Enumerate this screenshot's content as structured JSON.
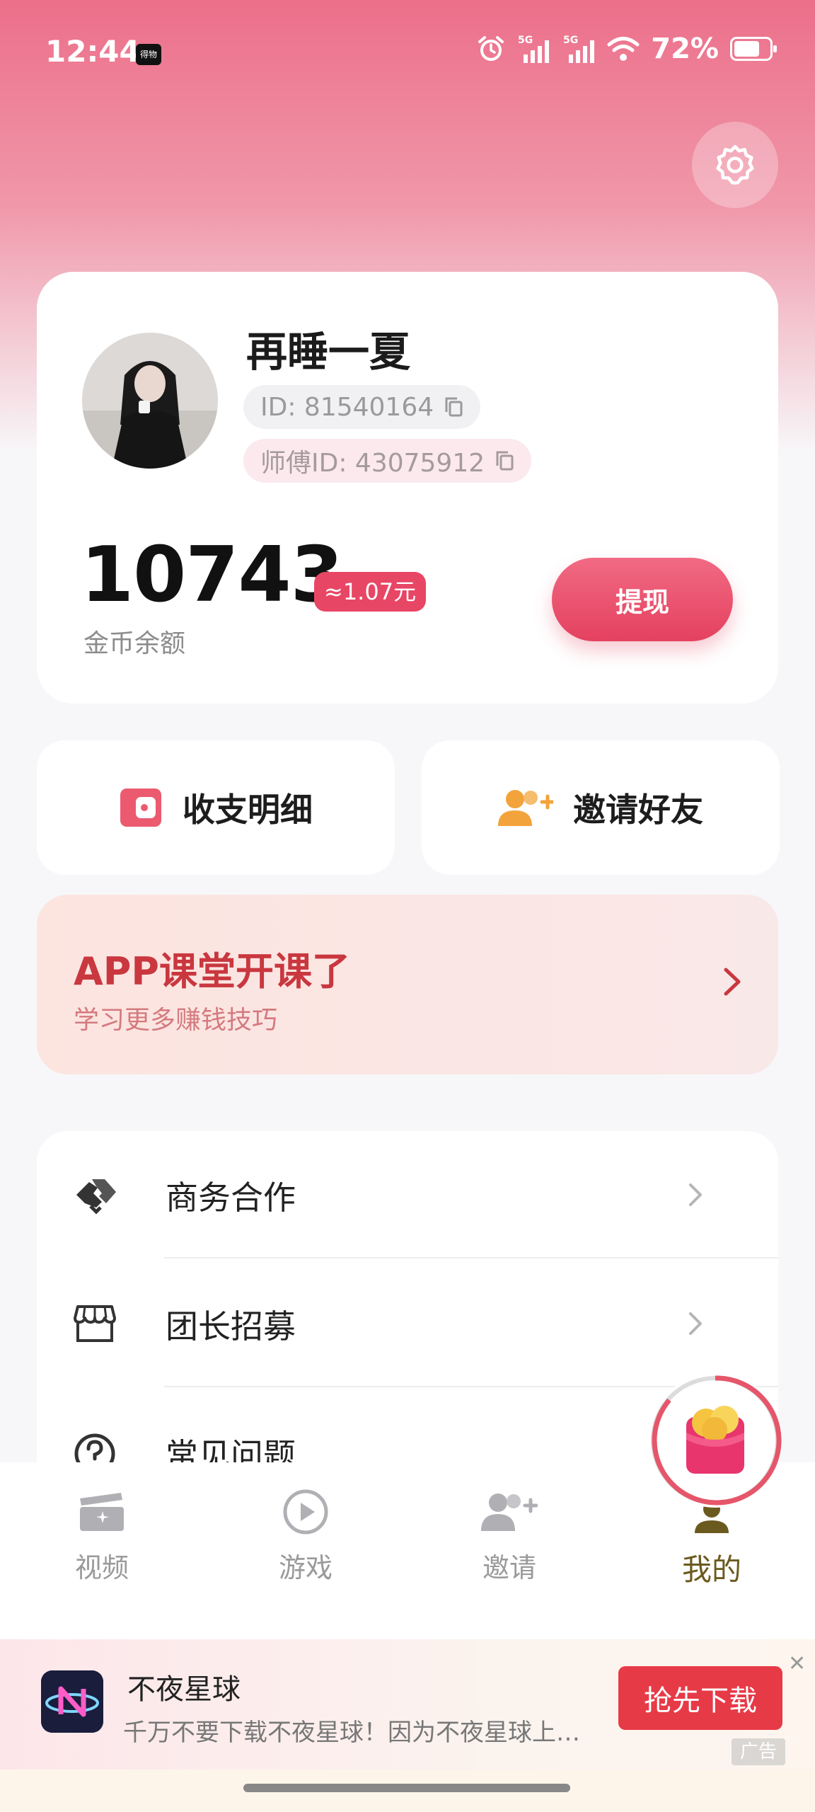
{
  "status_bar": {
    "time": "12:44",
    "app_badge": "得物",
    "network_1": "5G",
    "network_2": "5G",
    "battery_percent": "72%",
    "battery_level": 0.72
  },
  "profile": {
    "username": "再睡一夏",
    "id_text": "ID: 81540164",
    "master_id_text": "师傅ID: 43075912",
    "coins": "10743",
    "cash_equivalent": "≈1.07元",
    "coins_label": "金币余额",
    "withdraw_label": "提现"
  },
  "quick_actions": {
    "ledger_label": "收支明细",
    "invite_label": "邀请好友"
  },
  "course_banner": {
    "title": "APP课堂开课了",
    "subtitle": "学习更多赚钱技巧"
  },
  "menu": {
    "items": [
      {
        "label": "商务合作",
        "icon": "handshake-icon"
      },
      {
        "label": "团长招募",
        "icon": "store-icon"
      },
      {
        "label": "常见问题",
        "icon": "question-icon"
      }
    ]
  },
  "tabs": [
    {
      "label": "视频",
      "icon": "video-icon",
      "active": false
    },
    {
      "label": "游戏",
      "icon": "play-icon",
      "active": false
    },
    {
      "label": "邀请",
      "icon": "invite-icon",
      "active": false
    },
    {
      "label": "我的",
      "icon": "me-icon",
      "active": true
    }
  ],
  "ad": {
    "title": "不夜星球",
    "description": "千万不要下载不夜星球！因为不夜星球上…",
    "cta_label": "抢先下载",
    "close_label": "✕",
    "tag": "广告"
  },
  "colors": {
    "accent": "#e84665",
    "header_pink": "#ec6f8a",
    "course_title": "#c9373f",
    "ad_cta": "#e73a47"
  }
}
